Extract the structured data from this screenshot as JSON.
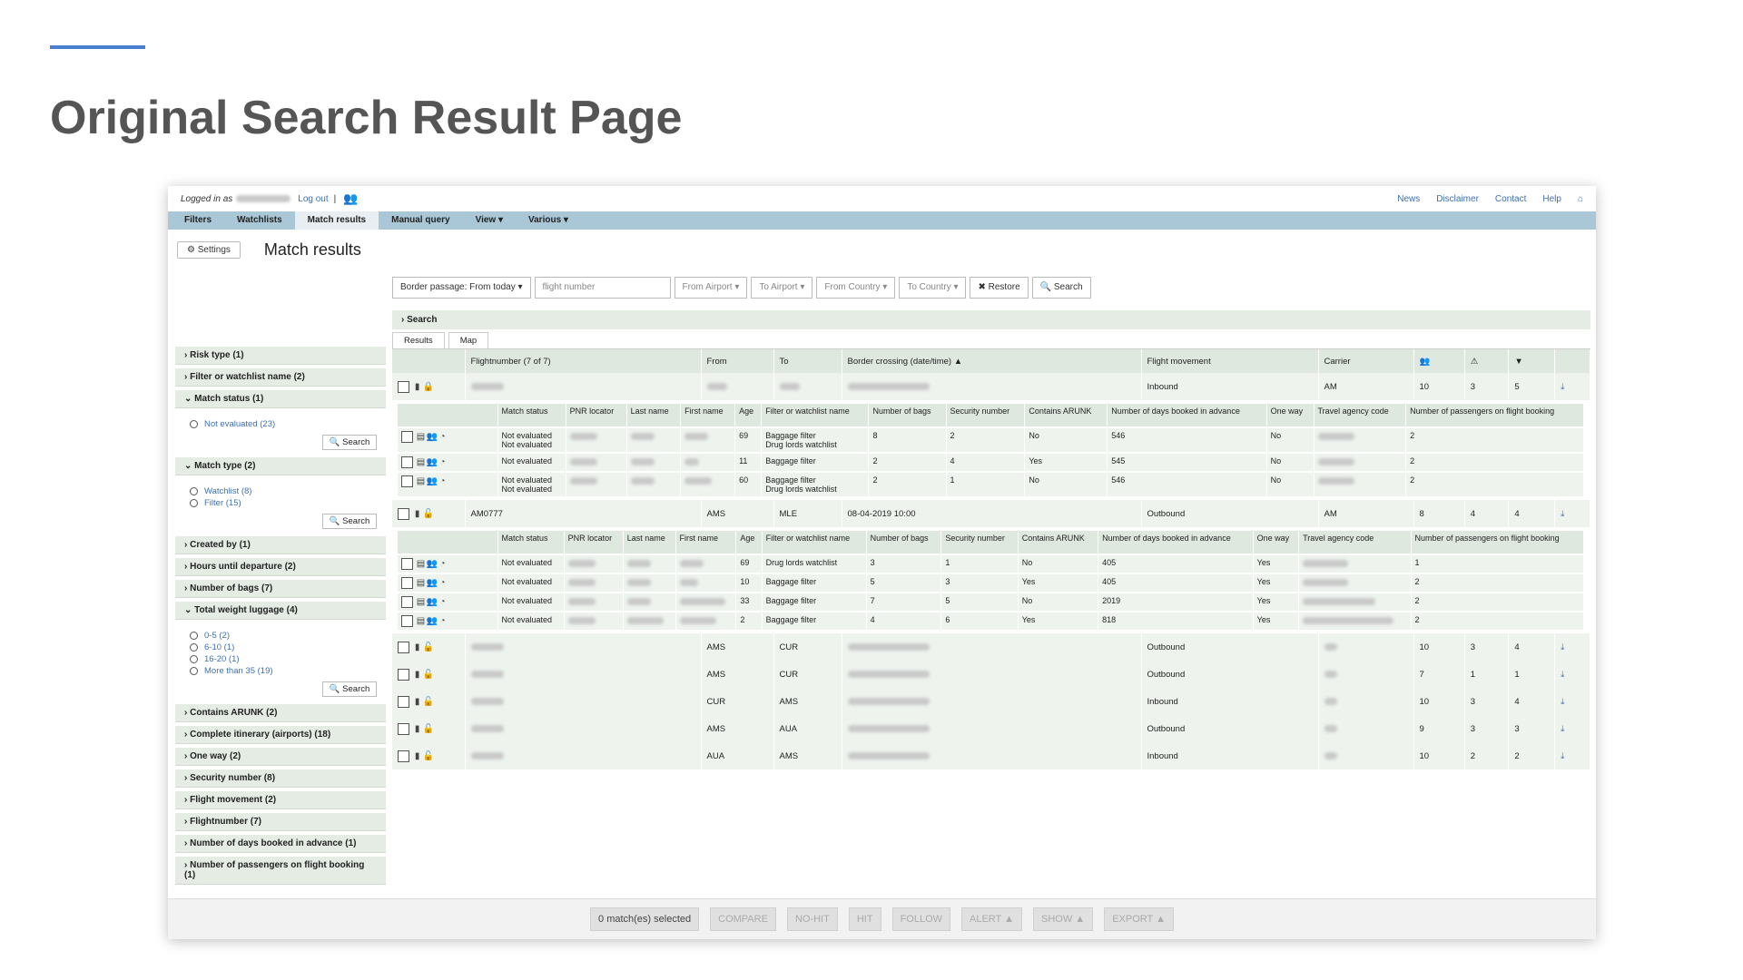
{
  "slide": {
    "title": "Original Search Result Page"
  },
  "topbar": {
    "logged_in": "Logged in as",
    "logout": "Log out",
    "separator": "|",
    "links": [
      "News",
      "Disclaimer",
      "Contact",
      "Help"
    ]
  },
  "nav": [
    "Filters",
    "Watchlists",
    "Match results",
    "Manual query",
    "View ▾",
    "Various ▾"
  ],
  "header": {
    "settings": "Settings",
    "title": "Match results"
  },
  "filters": {
    "border_passage": "Border passage: From today ▾",
    "flight_placeholder": "flight number",
    "from_airport": "From Airport ▾",
    "to_airport": "To Airport ▾",
    "from_country": "From Country ▾",
    "to_country": "To Country ▾",
    "restore": "✖ Restore",
    "search": "🔍 Search"
  },
  "sidebar": {
    "items": [
      "Risk type (1)",
      "Filter or watchlist name (2)"
    ],
    "match_status": {
      "label": "Match status (1)",
      "options": [
        "Not evaluated (23)"
      ],
      "search": "Search"
    },
    "match_type": {
      "label": "Match type (2)",
      "options": [
        "Watchlist (8)",
        "Filter (15)"
      ],
      "search": "Search"
    },
    "items2": [
      "Created by (1)",
      "Hours until departure (2)",
      "Number of bags (7)"
    ],
    "weight": {
      "label": "Total weight luggage (4)",
      "options": [
        "0-5 (2)",
        "6-10 (1)",
        "16-20 (1)",
        "More than 35 (19)"
      ],
      "search": "Search"
    },
    "items3": [
      "Contains ARUNK (2)",
      "Complete itinerary (airports) (18)",
      "One way (2)",
      "Security number (8)",
      "Flight movement (2)",
      "Flightnumber (7)",
      "Number of days booked in advance (1)",
      "Number of passengers on flight booking (1)"
    ]
  },
  "search_section": "Search",
  "tabs": [
    "Results",
    "Map"
  ],
  "main_table": {
    "headers": [
      "Flightnumber (7 of 7)",
      "From",
      "To",
      "Border crossing (date/time) ▲",
      "Flight movement",
      "Carrier"
    ],
    "flight1": {
      "movement": "Inbound",
      "carrier": "AM",
      "a": "10",
      "b": "3",
      "c": "5"
    },
    "flight2": {
      "number": "AM0777",
      "from": "AMS",
      "to": "MLE",
      "time": "08-04-2019 10:00",
      "movement": "Outbound",
      "carrier": "AM",
      "a": "8",
      "b": "4",
      "c": "4"
    },
    "rest": [
      {
        "from": "AMS",
        "to": "CUR",
        "movement": "Outbound",
        "a": "10",
        "b": "3",
        "c": "4"
      },
      {
        "from": "AMS",
        "to": "CUR",
        "movement": "Outbound",
        "a": "7",
        "b": "1",
        "c": "1"
      },
      {
        "from": "CUR",
        "to": "AMS",
        "movement": "Inbound",
        "a": "10",
        "b": "3",
        "c": "4"
      },
      {
        "from": "AMS",
        "to": "AUA",
        "movement": "Outbound",
        "a": "9",
        "b": "3",
        "c": "3"
      },
      {
        "from": "AUA",
        "to": "AMS",
        "movement": "Inbound",
        "a": "10",
        "b": "2",
        "c": "2"
      }
    ]
  },
  "sub1": {
    "headers": [
      "Match status",
      "PNR locator",
      "Last name",
      "First name",
      "Age",
      "Filter or watchlist name",
      "Number of bags",
      "Security number",
      "Contains ARUNK",
      "Number of days booked in advance",
      "One way",
      "Travel agency code",
      "Number of passengers on flight booking"
    ],
    "rows": [
      {
        "status": "Not evaluated\nNot evaluated",
        "age": "69",
        "filter": "Baggage filter\nDrug lords watchlist",
        "bags": "8",
        "sec": "2",
        "arunk": "No",
        "days": "546",
        "oneway": "No",
        "pax": "2"
      },
      {
        "status": "Not evaluated",
        "age": "11",
        "filter": "Baggage filter",
        "bags": "2",
        "sec": "4",
        "arunk": "Yes",
        "days": "545",
        "oneway": "No",
        "pax": "2"
      },
      {
        "status": "Not evaluated\nNot evaluated",
        "age": "60",
        "filter": "Baggage filter\nDrug lords watchlist",
        "bags": "2",
        "sec": "1",
        "arunk": "No",
        "days": "546",
        "oneway": "No",
        "pax": "2"
      }
    ]
  },
  "sub2": {
    "headers": [
      "Match status",
      "PNR locator",
      "Last name",
      "First name",
      "Age",
      "Filter or watchlist name",
      "Number of bags",
      "Security number",
      "Contains ARUNK",
      "Number of days booked in advance",
      "One way",
      "Travel agency code",
      "Number of passengers on flight booking"
    ],
    "rows": [
      {
        "status": "Not evaluated",
        "age": "69",
        "filter": "Drug lords watchlist",
        "bags": "3",
        "sec": "1",
        "arunk": "No",
        "days": "405",
        "oneway": "Yes",
        "pax": "1"
      },
      {
        "status": "Not evaluated",
        "age": "10",
        "filter": "Baggage filter",
        "bags": "5",
        "sec": "3",
        "arunk": "Yes",
        "days": "405",
        "oneway": "Yes",
        "pax": "2"
      },
      {
        "status": "Not evaluated",
        "age": "33",
        "filter": "Baggage filter",
        "bags": "7",
        "sec": "5",
        "arunk": "No",
        "days": "2019",
        "oneway": "Yes",
        "pax": "2"
      },
      {
        "status": "Not evaluated",
        "age": "2",
        "filter": "Baggage filter",
        "bags": "4",
        "sec": "6",
        "arunk": "Yes",
        "days": "818",
        "oneway": "Yes",
        "pax": "2"
      }
    ]
  },
  "bottom": {
    "selected": "0 match(es) selected",
    "compare": "COMPARE",
    "nohit": "NO-HIT",
    "hit": "HIT",
    "follow": "FOLLOW",
    "alert": "ALERT ▲",
    "show": "SHOW ▲",
    "export": "EXPORT ▲"
  }
}
